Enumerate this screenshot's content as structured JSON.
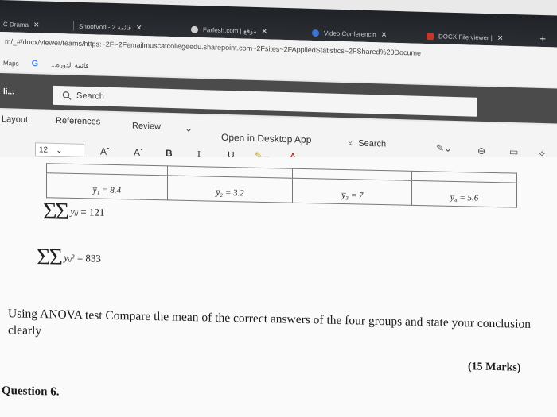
{
  "tabs": [
    {
      "label": "C Drama",
      "icon": "tv-icon"
    },
    {
      "label": "ShoofVod - 2 قائمة",
      "icon": "video-icon"
    },
    {
      "label": "Farfesh.com | موقع",
      "icon": "globe-icon"
    },
    {
      "label": "Video Conferencin",
      "icon": "grid-icon"
    },
    {
      "label": "DOCX File viewer |",
      "icon": "word-icon"
    }
  ],
  "url": "m/_#/docx/viewer/teams/https:~2F~2Femailmuscatcollegeedu.sharepoint.com~2Fsites~2FAppliedStatistics~2FShared%20Docume",
  "bookmarks": [
    {
      "label": "Maps"
    },
    {
      "label": "G"
    },
    {
      "label": "...قائمة الدورة"
    }
  ],
  "app": {
    "name": "li..."
  },
  "search": {
    "placeholder": "Search"
  },
  "ribbon": {
    "tabs": [
      "Layout",
      "References",
      "Review"
    ],
    "open_desktop": "Open in Desktop App",
    "search_label": "Search",
    "font_size": "12",
    "bold": "B",
    "italic": "I",
    "underline": "U",
    "grow_font": "Aˆ",
    "shrink_font": "Aˇ",
    "more": "..."
  },
  "doc": {
    "means": [
      "y̅₁ = 8.4",
      "y̅₂ = 3.2",
      "y̅₃ = 7",
      "y̅₄ = 5.6"
    ],
    "formula1_var": "yᵢⱼ",
    "formula1_rest": "= 121",
    "formula2_var": "yᵢⱼ²",
    "formula2_rest": "= 833",
    "question": "Using ANOVA test Compare the mean of the correct answers of the four groups and state your conclusion clearly",
    "marks": "(15 Marks)",
    "next_question": "Question 6."
  },
  "colors": {
    "chrome": "#1f2227",
    "office": "#4b4b4b",
    "ribbon": "#f4f4f4",
    "page": "#fafafa"
  }
}
